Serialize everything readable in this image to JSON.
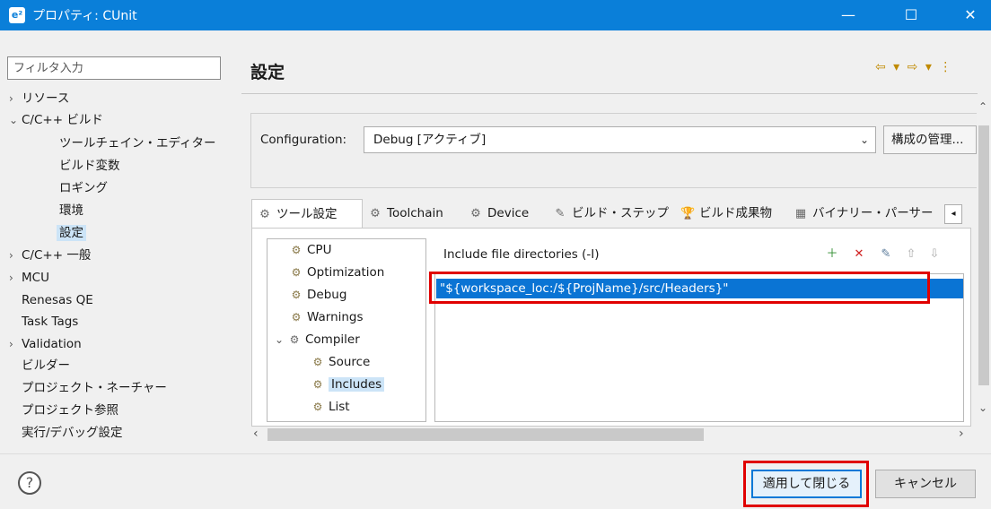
{
  "window": {
    "app_icon": "e²",
    "title": "プロパティ: CUnit",
    "minimize": "—",
    "maximize": "☐",
    "close": "✕"
  },
  "sidebar": {
    "filter_placeholder": "フィルタ入力",
    "items": [
      {
        "label": "リソース",
        "arrow": "›",
        "level": 0
      },
      {
        "label": "C/C++ ビルド",
        "arrow": "⌄",
        "level": 0
      },
      {
        "label": "ツールチェイン・エディター",
        "arrow": "",
        "level": 1
      },
      {
        "label": "ビルド変数",
        "arrow": "",
        "level": 1
      },
      {
        "label": "ロギング",
        "arrow": "",
        "level": 1
      },
      {
        "label": "環境",
        "arrow": "",
        "level": 1
      },
      {
        "label": "設定",
        "arrow": "",
        "level": 1,
        "selected": true
      },
      {
        "label": "C/C++ 一般",
        "arrow": "›",
        "level": 0
      },
      {
        "label": "MCU",
        "arrow": "›",
        "level": 0
      },
      {
        "label": "Renesas QE",
        "arrow": "",
        "level": 0
      },
      {
        "label": "Task Tags",
        "arrow": "",
        "level": 0
      },
      {
        "label": "Validation",
        "arrow": "›",
        "level": 0
      },
      {
        "label": "ビルダー",
        "arrow": "",
        "level": 0
      },
      {
        "label": "プロジェクト・ネーチャー",
        "arrow": "",
        "level": 0
      },
      {
        "label": "プロジェクト参照",
        "arrow": "",
        "level": 0
      },
      {
        "label": "実行/デバッグ設定",
        "arrow": "",
        "level": 0
      }
    ]
  },
  "main": {
    "title": "設定",
    "nav_arrows": "⇦ ▾ ⇨ ▾ ⋮",
    "config_label": "Configuration:",
    "config_value": "Debug [アクティブ]",
    "config_arrow": "⌄",
    "manage_config": "構成の管理...",
    "scroll_up": "⌃",
    "scroll_down": "⌄",
    "tabs": [
      {
        "label": "ツール設定",
        "icon": "⚙",
        "active": true
      },
      {
        "label": "Toolchain",
        "icon": "⚙"
      },
      {
        "label": "Device",
        "icon": "⚙"
      },
      {
        "label": "ビルド・ステップ",
        "icon": "✎"
      },
      {
        "label": "ビルド成果物",
        "icon": "🏆"
      },
      {
        "label": "バイナリー・パーサー",
        "icon": "▦"
      }
    ],
    "tab_scroll": "◂",
    "tool_tree": [
      {
        "label": "CPU",
        "indent": 1
      },
      {
        "label": "Optimization",
        "indent": 1
      },
      {
        "label": "Debug",
        "indent": 1
      },
      {
        "label": "Warnings",
        "indent": 1
      },
      {
        "label": "Compiler",
        "indent": 0,
        "arrow": "⌄"
      },
      {
        "label": "Source",
        "indent": 2
      },
      {
        "label": "Includes",
        "indent": 2,
        "selected": true
      },
      {
        "label": "List",
        "indent": 2
      }
    ],
    "include_title": "Include file directories (-I)",
    "include_tools": [
      "add-icon",
      "delete-icon",
      "edit-icon",
      "move-up-icon",
      "move-down-icon"
    ],
    "include_paths": [
      "\"${workspace_loc:/${ProjName}/src/Headers}\""
    ],
    "hscroll_left": "‹",
    "hscroll_right": "›"
  },
  "footer": {
    "help": "?",
    "apply_close": "適用して閉じる",
    "cancel": "キャンセル"
  },
  "colors": {
    "titlebar": "#0a7fd9",
    "selection": "#0a74d4",
    "highlight": "#e00000"
  }
}
